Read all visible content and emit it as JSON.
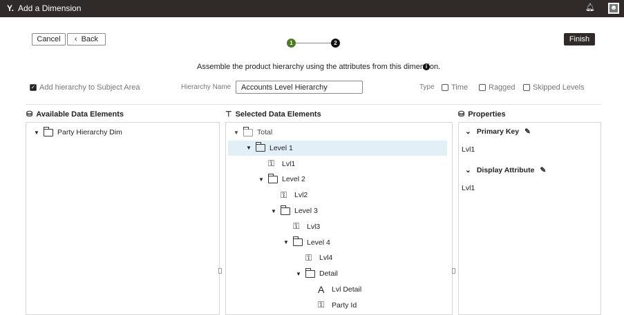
{
  "header": {
    "title": "Add a Dimension",
    "logo": "Y.",
    "icons": [
      "bell-icon",
      "user-profile-icon"
    ]
  },
  "toolbar": {
    "cancel": "Cancel",
    "back": "Back",
    "finish": "Finish"
  },
  "stepper": {
    "steps": [
      "1",
      "2"
    ],
    "current": 1,
    "colors": {
      "done": "#4e7a26",
      "pending": "#111111"
    }
  },
  "instruction": "Assemble the product hierarchy using the attributes from this dimension.",
  "form": {
    "add_to_subject_area": {
      "label": "Add hierarchy to Subject Area",
      "checked": true
    },
    "hierarchy_name_label": "Hierarchy Name",
    "hierarchy_name_value": "Accounts Level Hierarchy",
    "type_label": "Type",
    "types": [
      {
        "label": "Time",
        "checked": false
      },
      {
        "label": "Ragged",
        "checked": false
      },
      {
        "label": "Skipped Levels",
        "checked": false
      }
    ]
  },
  "available": {
    "title": "Available Data Elements",
    "items": [
      {
        "label": "Party Hierarchy Dim",
        "icon": "folder-icon",
        "expanded": true
      }
    ]
  },
  "selected": {
    "title": "Selected Data Elements",
    "items": [
      {
        "label": "Total",
        "icon": "folder",
        "depth": 0,
        "toggle": true,
        "muted": true
      },
      {
        "label": "Level 1",
        "icon": "folder",
        "depth": 1,
        "toggle": true,
        "selected": true
      },
      {
        "label": "Lvl1",
        "icon": "key",
        "depth": 2
      },
      {
        "label": "Level 2",
        "icon": "folder",
        "depth": 2,
        "toggle": true
      },
      {
        "label": "Lvl2",
        "icon": "key",
        "depth": 3
      },
      {
        "label": "Level 3",
        "icon": "folder",
        "depth": 3,
        "toggle": true
      },
      {
        "label": "Lvl3",
        "icon": "key",
        "depth": 4
      },
      {
        "label": "Level 4",
        "icon": "folder",
        "depth": 4,
        "toggle": true
      },
      {
        "label": "Lvl4",
        "icon": "key",
        "depth": 5
      },
      {
        "label": "Detail",
        "icon": "folder",
        "depth": 5,
        "toggle": true
      },
      {
        "label": "Lvl Detail",
        "icon": "attribute",
        "depth": 6
      },
      {
        "label": "Party Id",
        "icon": "key",
        "depth": 6
      }
    ]
  },
  "properties": {
    "title": "Properties",
    "sections": [
      {
        "title": "Primary Key",
        "value": "Lvl1"
      },
      {
        "title": "Display Attribute",
        "value": "Lvl1"
      }
    ]
  }
}
